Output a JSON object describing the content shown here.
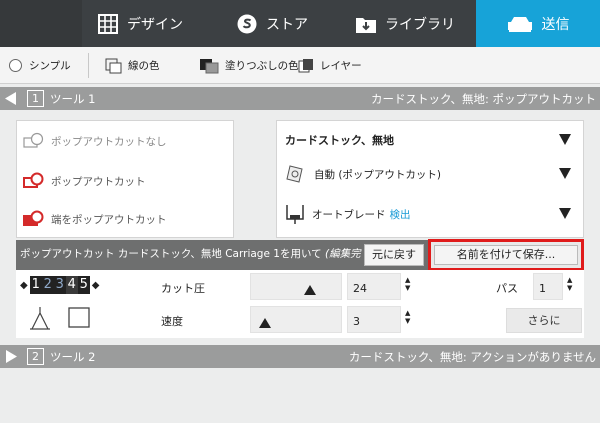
{
  "nav": {
    "tabs": [
      {
        "label": "デザイン",
        "icon": "grid-icon"
      },
      {
        "label": "ストア",
        "icon": "store-s-icon"
      },
      {
        "label": "ライブラリ",
        "icon": "download-folder-icon"
      },
      {
        "label": "送信",
        "icon": "cutter-machine-icon"
      }
    ],
    "active_color": "#17a3d8"
  },
  "subbar": {
    "simple": "シンプル",
    "line_color": "線の色",
    "fill_color": "塗りつぶしの色",
    "layer": "レイヤー"
  },
  "tool1": {
    "number": "1",
    "name": "ツール 1",
    "status": "カードストック、無地: ポップアウトカット"
  },
  "cut_options": {
    "none": "ポップアウトカットなし",
    "popout": "ポップアウトカット",
    "edge": "端をポップアウトカット"
  },
  "material": {
    "name": "カードストック、無地",
    "action": "自動 (ポップアウトカット)",
    "blade": "オートブレード",
    "detect": "検出"
  },
  "status_row": {
    "text": "ポップアウトカット カードストック、無地 Carriage 1を用いて",
    "edited": "(編集完",
    "revert": "元に戻す",
    "save_as": "名前を付けて保存..."
  },
  "settings": {
    "blade_digits": [
      "1",
      "2",
      "3",
      "4",
      "5"
    ],
    "selected_blade": "4",
    "pressure_label": "カット圧",
    "pressure_value": "24",
    "pressure_fraction": 0.68,
    "speed_label": "速度",
    "speed_value": "3",
    "speed_fraction": 0.1,
    "pass_label": "パス",
    "pass_value": "1",
    "more": "さらに"
  },
  "tool2": {
    "number": "2",
    "name": "ツール 2",
    "status": "カードストック、無地: アクションがありません"
  },
  "colors": {
    "highlight_border": "#e01b1b",
    "link": "#1a9bd6",
    "popout_icon": "#d42a2a"
  }
}
